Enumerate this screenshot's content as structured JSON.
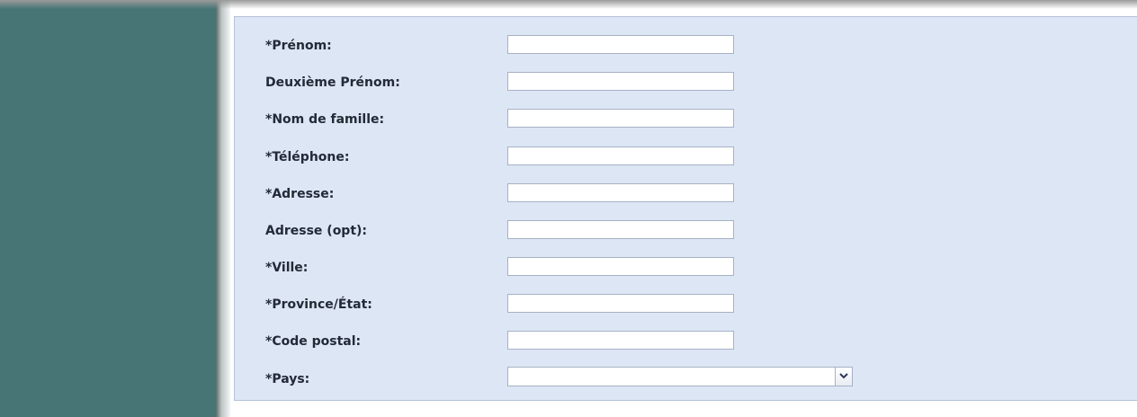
{
  "form": {
    "fields": [
      {
        "label": "*Prénom:",
        "value": ""
      },
      {
        "label": "Deuxième Prénom:",
        "value": ""
      },
      {
        "label": "*Nom de famille:",
        "value": ""
      },
      {
        "label": "*Téléphone:",
        "value": ""
      },
      {
        "label": "*Adresse:",
        "value": ""
      },
      {
        "label": "Adresse (opt):",
        "value": ""
      },
      {
        "label": "*Ville:",
        "value": ""
      },
      {
        "label": "*Province/État:",
        "value": ""
      },
      {
        "label": "*Code postal:",
        "value": ""
      }
    ],
    "country": {
      "label": "*Pays:",
      "selected": ""
    }
  },
  "colors": {
    "sidebar": "#477575",
    "panel_background": "#dde6f5",
    "panel_border": "#b4c2d8",
    "label_text": "#222a38"
  }
}
